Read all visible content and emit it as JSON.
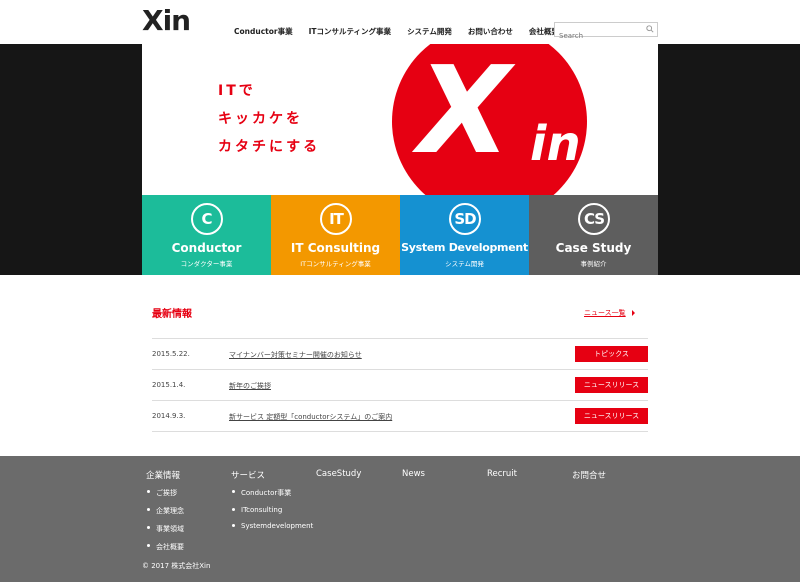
{
  "brand": {
    "logo_text": "Xin",
    "accent": "#e60012"
  },
  "nav": {
    "items": [
      {
        "label": "Conductor事業"
      },
      {
        "label": "ITコンサルティング事業"
      },
      {
        "label": "システム開発"
      },
      {
        "label": "お問い合わせ"
      },
      {
        "label": "会社概要"
      }
    ]
  },
  "search": {
    "placeholder": "Search",
    "icon": "search-icon"
  },
  "hero": {
    "tagline": [
      "ITで",
      "キッカケを",
      "カタチにする"
    ],
    "logo_big_x": "X",
    "logo_big_in": "in"
  },
  "tiles": [
    {
      "abbr": "C",
      "title": "Conductor",
      "sub": "コンダクター事業",
      "color": "#1cbc9a"
    },
    {
      "abbr": "IT",
      "title": "IT Consulting",
      "sub": "ITコンサルティング事業",
      "color": "#f39800"
    },
    {
      "abbr": "SD",
      "title": "System Development",
      "sub": "システム開発",
      "color": "#1591d1"
    },
    {
      "abbr": "CS",
      "title": "Case Study",
      "sub": "事例紹介",
      "color": "#5e5e5e"
    }
  ],
  "news": {
    "heading": "最新情報",
    "more_label": "ニュース一覧",
    "items": [
      {
        "date": "2015.5.22.",
        "title": "マイナンバー対策セミナー開催のお知らせ",
        "badge": "トピックス"
      },
      {
        "date": "2015.1.4.",
        "title": "新年のご挨拶",
        "badge": "ニュースリリース"
      },
      {
        "date": "2014.9.3.",
        "title": "新サービス 定額型「conductorシステム」のご案内",
        "badge": "ニュースリリース"
      }
    ]
  },
  "footer": {
    "columns": [
      {
        "heading": "企業情報",
        "links": [
          "ご挨拶",
          "企業理念",
          "事業領域",
          "会社概要"
        ]
      },
      {
        "heading": "サービス",
        "links": [
          "Conductor事業",
          "ITconsulting",
          "Systemdevelopment"
        ]
      },
      {
        "heading": "CaseStudy",
        "links": []
      },
      {
        "heading": "News",
        "links": []
      },
      {
        "heading": "Recruit",
        "links": []
      },
      {
        "heading": "お問合せ",
        "links": []
      }
    ],
    "copyright": "© 2017 株式会社Xin"
  }
}
